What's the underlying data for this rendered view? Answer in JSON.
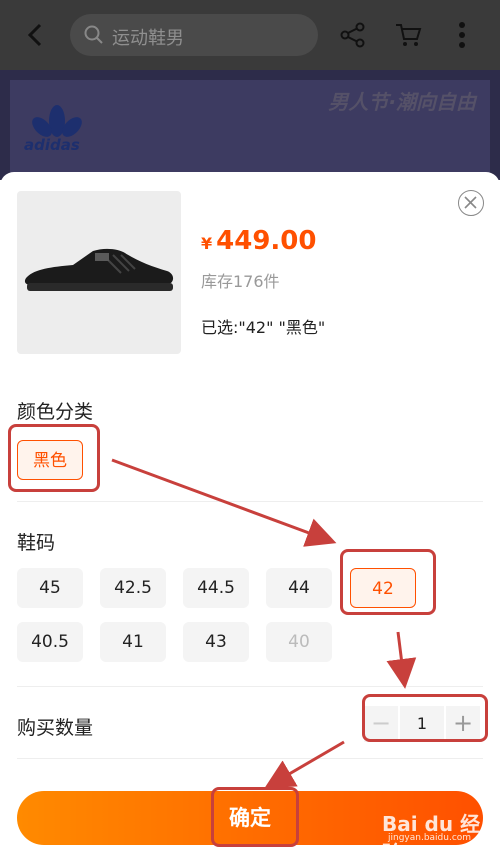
{
  "header": {
    "search_text": "运动鞋男"
  },
  "banner": {
    "brand": "adidas",
    "slogan": "男人节·潮向自由"
  },
  "product": {
    "currency": "¥",
    "price": "449.00",
    "stock": "库存176件",
    "selected": "已选:\"42\" \"黑色\""
  },
  "color_section": {
    "title": "颜色分类",
    "options": [
      "黑色"
    ]
  },
  "size_section": {
    "title": "鞋码",
    "options": [
      "45",
      "42.5",
      "44.5",
      "44",
      "42",
      "40.5",
      "41",
      "43",
      "40"
    ],
    "selected": "42",
    "disabled": "40"
  },
  "quantity_section": {
    "title": "购买数量",
    "minus": "−",
    "value": "1",
    "plus": "+"
  },
  "confirm_label": "确定",
  "watermark": {
    "text": "Bai du 经验",
    "url": "jingyan.baidu.com"
  },
  "colors": {
    "accent": "#ff5000",
    "annotation": "#c8403c"
  }
}
